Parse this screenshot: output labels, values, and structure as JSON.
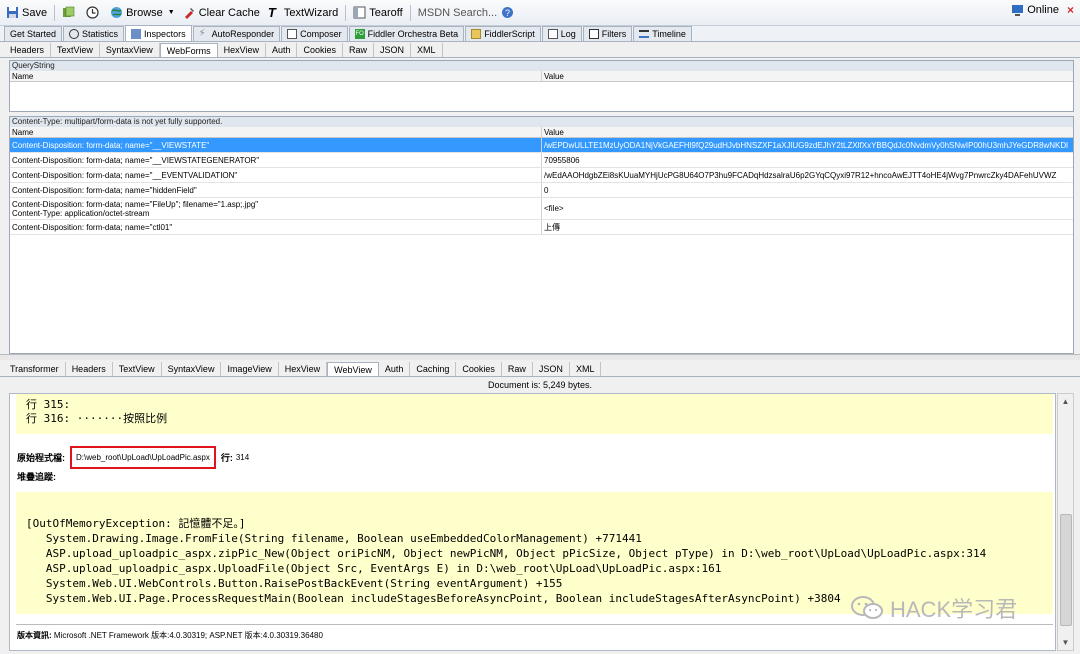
{
  "toolbar": {
    "save": "Save",
    "browse": "Browse",
    "clear_cache": "Clear Cache",
    "text_wizard": "TextWizard",
    "tearoff": "Tearoff",
    "search_placeholder": "MSDN Search...",
    "online": "Online"
  },
  "main_tabs": [
    "Get Started",
    "Statistics",
    "Inspectors",
    "AutoResponder",
    "Composer",
    "Fiddler Orchestra Beta",
    "FiddlerScript",
    "Log",
    "Filters",
    "Timeline"
  ],
  "request_tabs": [
    "Headers",
    "TextView",
    "SyntaxView",
    "WebForms",
    "HexView",
    "Auth",
    "Cookies",
    "Raw",
    "JSON",
    "XML"
  ],
  "querystring": {
    "title": "QueryString",
    "col_name": "Name",
    "col_value": "Value"
  },
  "body": {
    "title": "Content-Type: multipart/form-data is not yet fully supported.",
    "col_name": "Name",
    "col_value": "Value",
    "rows": [
      {
        "name": "Content-Disposition: form-data; name=\"__VIEWSTATE\"",
        "value": "/wEPDwULLTE1MzUyODA1NjVkGAEFHl9fQ29udHJvbHNSZXF1aXJlUG9zdEJhY2tLZXlfXxYBBQdJc0NvdmVy0hSNwIP00hU3mhJYeGDR8wNKDl"
      },
      {
        "name": "Content-Disposition: form-data; name=\"__VIEWSTATEGENERATOR\"",
        "value": "70955806"
      },
      {
        "name": "Content-Disposition: form-data; name=\"__EVENTVALIDATION\"",
        "value": "/wEdAAOHdgbZEi8sKUuaMYHjUcPG8U64O7P3hu9FCADqHdzsalraU6p2GYqCQyxi97R12+hncoAwEJTT4oHE4jWvg7PnwrcZky4DAFehUVWZ"
      },
      {
        "name": "Content-Disposition: form-data; name=\"hiddenField\"",
        "value": "0"
      },
      {
        "name": "Content-Disposition: form-data; name=\"FileUp\"; filename=\"1.asp;.jpg\"",
        "name2": "Content-Type: application/octet-stream",
        "value": "<file>"
      },
      {
        "name": "Content-Disposition: form-data; name=\"ctl01\"",
        "value": "上傳"
      }
    ]
  },
  "response_tabs": [
    "Transformer",
    "Headers",
    "TextView",
    "SyntaxView",
    "ImageView",
    "HexView",
    "WebView",
    "Auth",
    "Caching",
    "Cookies",
    "Raw",
    "JSON",
    "XML"
  ],
  "doc_info": "Document is: 5,249 bytes.",
  "webview": {
    "line315": "行 315:",
    "line316": "行 316:         ·······按照比例",
    "source_label": "原始程式檔:",
    "source_path": "D:\\web_root\\UpLoad\\UpLoadPic.aspx",
    "line_label": "行:",
    "line_no": "314",
    "stack_label": "堆疊追蹤:",
    "stack": "[OutOfMemoryException: 記憶體不足。]\n   System.Drawing.Image.FromFile(String filename, Boolean useEmbeddedColorManagement) +771441\n   ASP.upload_uploadpic_aspx.zipPic_New(Object oriPicNM, Object newPicNM, Object pPicSize, Object pType) in D:\\web_root\\UpLoad\\UpLoadPic.aspx:314\n   ASP.upload_uploadpic_aspx.UploadFile(Object Src, EventArgs E) in D:\\web_root\\UpLoad\\UpLoadPic.aspx:161\n   System.Web.UI.WebControls.Button.RaisePostBackEvent(String eventArgument) +155\n   System.Web.UI.Page.ProcessRequestMain(Boolean includeStagesBeforeAsyncPoint, Boolean includeStagesAfterAsyncPoint) +3804",
    "version_label": "版本資訊:",
    "version_text": "Microsoft .NET Framework 版本:4.0.30319; ASP.NET 版本:4.0.30319.36480"
  },
  "watermark": "HACK学习君"
}
